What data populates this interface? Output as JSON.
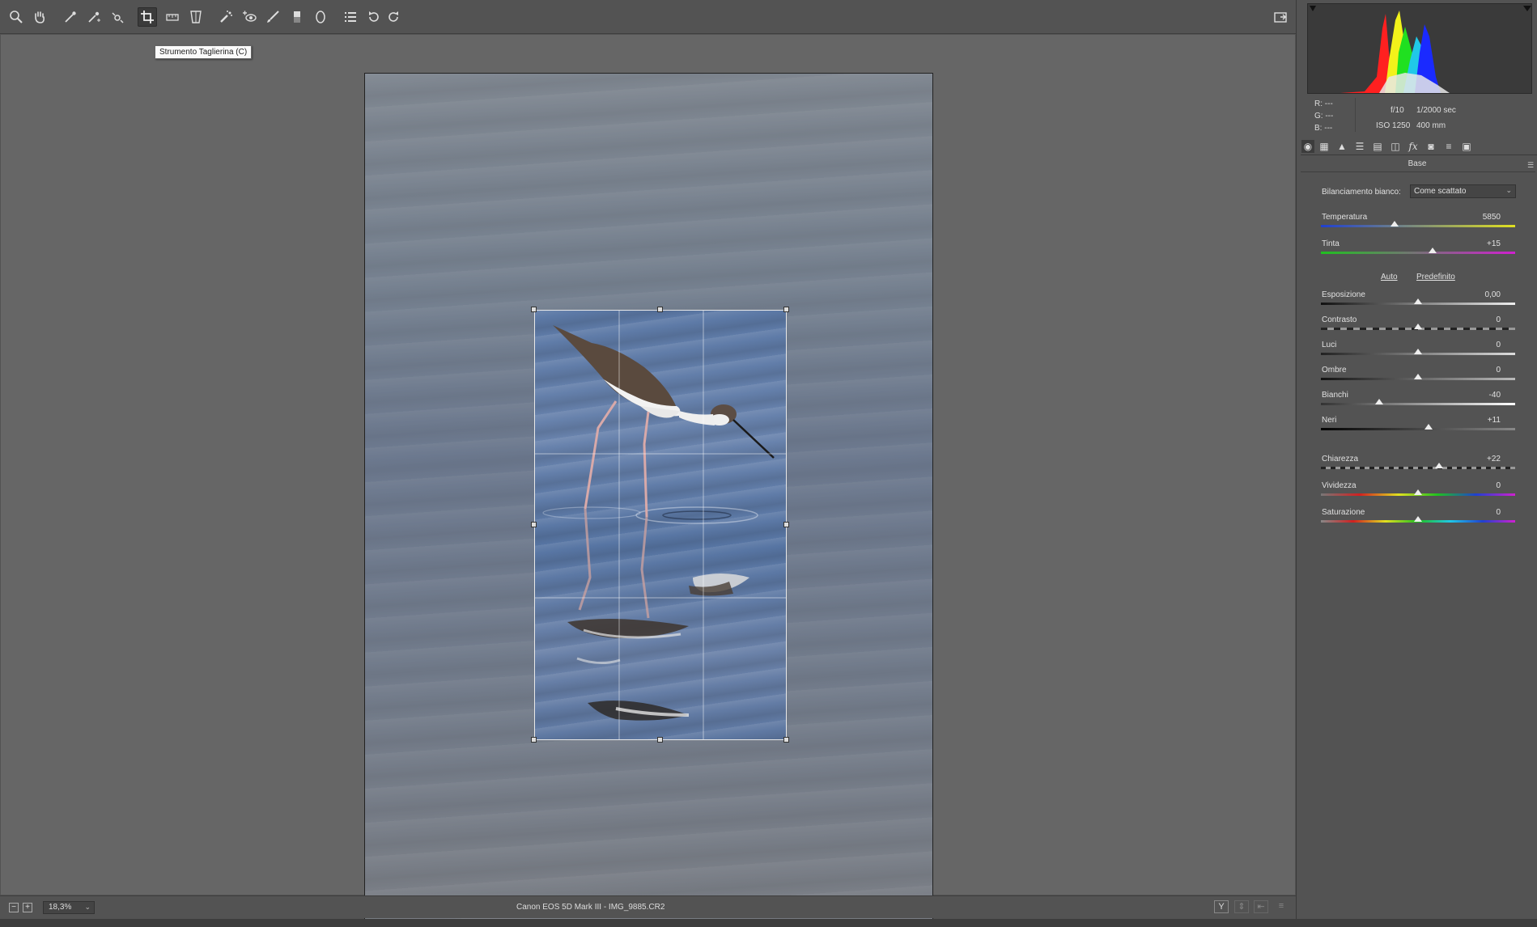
{
  "toolbar": {
    "tools": [
      {
        "name": "zoom-tool-icon",
        "active": false
      },
      {
        "name": "hand-tool-icon",
        "active": false
      },
      {
        "name": "white-balance-tool-icon",
        "active": false
      },
      {
        "name": "color-sampler-tool-icon",
        "active": false
      },
      {
        "name": "targeted-adjustment-tool-icon",
        "active": false
      },
      {
        "name": "crop-tool-icon",
        "active": true
      },
      {
        "name": "straighten-tool-icon",
        "active": false
      },
      {
        "name": "transform-tool-icon",
        "active": false
      },
      {
        "name": "spot-removal-tool-icon",
        "active": false
      },
      {
        "name": "red-eye-tool-icon",
        "active": false
      },
      {
        "name": "adjustment-brush-icon",
        "active": false
      },
      {
        "name": "graduated-filter-icon",
        "active": false
      },
      {
        "name": "radial-filter-icon",
        "active": false
      },
      {
        "name": "preferences-icon",
        "active": false
      },
      {
        "name": "rotate-left-icon",
        "active": false
      },
      {
        "name": "rotate-right-icon",
        "active": false
      }
    ],
    "tooltip": "Strumento Taglierina (C)"
  },
  "status": {
    "zoom": "18,3%",
    "caption": "Canon EOS 5D Mark III  -  IMG_9885.CR2"
  },
  "histogram": {
    "rgb_labels": [
      "R:",
      "G:",
      "B:"
    ],
    "rgb_values": [
      "---",
      "---",
      "---"
    ],
    "aperture": "f/10",
    "shutter": "1/2000 sec",
    "iso": "ISO 1250",
    "focal": "400 mm"
  },
  "panel": {
    "title": "Base",
    "wb_label": "Bilanciamento bianco:",
    "wb_value": "Come scattato",
    "auto_link": "Auto",
    "default_link": "Predefinito",
    "sliders": {
      "temperatura": {
        "label": "Temperatura",
        "value": "5850",
        "pos": 0.38
      },
      "tinta": {
        "label": "Tinta",
        "value": "+15",
        "pos": 0.575
      },
      "esposizione": {
        "label": "Esposizione",
        "value": "0,00",
        "pos": 0.5
      },
      "contrasto": {
        "label": "Contrasto",
        "value": "0",
        "pos": 0.5
      },
      "luci": {
        "label": "Luci",
        "value": "0",
        "pos": 0.5
      },
      "ombre": {
        "label": "Ombre",
        "value": "0",
        "pos": 0.5
      },
      "bianchi": {
        "label": "Bianchi",
        "value": "-40",
        "pos": 0.3
      },
      "neri": {
        "label": "Neri",
        "value": "+11",
        "pos": 0.555
      },
      "chiarezza": {
        "label": "Chiarezza",
        "value": "+22",
        "pos": 0.61
      },
      "vividezza": {
        "label": "Vividezza",
        "value": "0",
        "pos": 0.5
      },
      "saturazione": {
        "label": "Saturazione",
        "value": "0",
        "pos": 0.5
      }
    }
  },
  "colors": {
    "accent": "#ffffff",
    "panel_bg": "#535353",
    "canvas_bg": "#666666"
  }
}
